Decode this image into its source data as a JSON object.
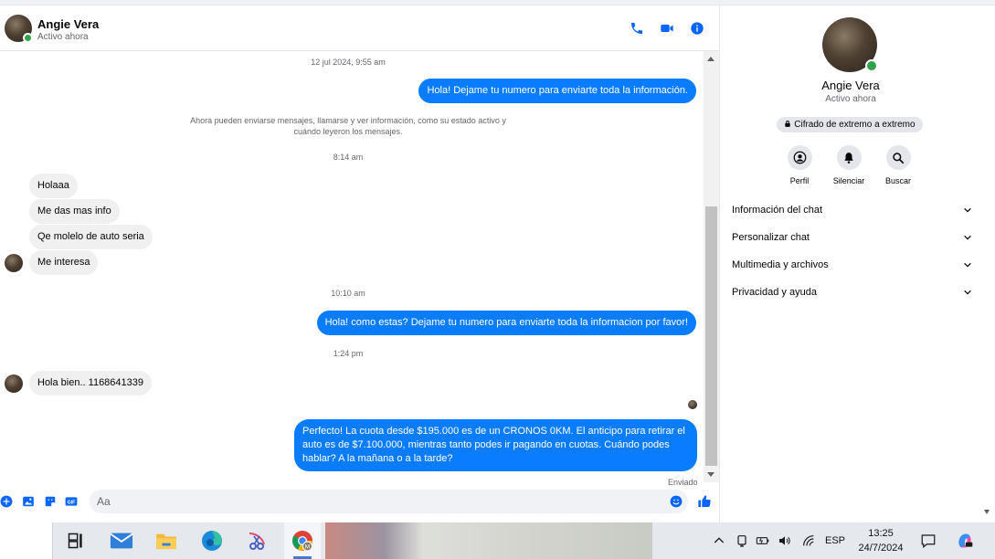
{
  "contact": {
    "name": "Angie Vera",
    "status": "Activo ahora"
  },
  "messages": {
    "ts1": "12 jul 2024, 9:55 am",
    "out1": "Hola! Dejame tu numero  para enviarte toda la información.",
    "system_note": "Ahora pueden enviarse mensajes, llamarse y ver información, como su estado activo y cuándo leyeron los mensajes.",
    "ts2": "8:14 am",
    "in1": "Holaaa",
    "in2": "Me das mas info",
    "in3": "Qe molelo de auto seria",
    "in4": "Me interesa",
    "ts3": "10:10 am",
    "out2": "Hola! como estas? Dejame tu numero para enviarte toda la informacion por favor!",
    "ts4": "1:24 pm",
    "in5": "Hola bien.. 1168641339",
    "out3": "Perfecto! La cuota desde $195.000 es de un CRONOS 0KM. El anticipo para retirar el auto es de $7.100.000, mientras tanto podes ir pagando en cuotas. Cuándo podes hablar? A la mañana o a la tarde?",
    "delivery_status": "Enviado"
  },
  "composer": {
    "placeholder": "Aa",
    "value": ""
  },
  "info": {
    "name": "Angie Vera",
    "status": "Activo ahora",
    "encryption": "Cifrado de extremo a extremo",
    "actions": {
      "profile": "Perfil",
      "mute": "Silenciar",
      "search": "Buscar"
    },
    "sections": {
      "chat_info": "Información del chat",
      "customize": "Personalizar chat",
      "media": "Multimedia y archivos",
      "privacy": "Privacidad y ayuda"
    }
  },
  "taskbar": {
    "language": "ESP",
    "time": "13:25",
    "date": "24/7/2024",
    "chrome_badge": "M"
  },
  "colors": {
    "messenger_blue": "#0a7cff",
    "bubble_in": "#f0f0f0",
    "online_green": "#31a24c",
    "icon_blue": "#0866ff"
  }
}
